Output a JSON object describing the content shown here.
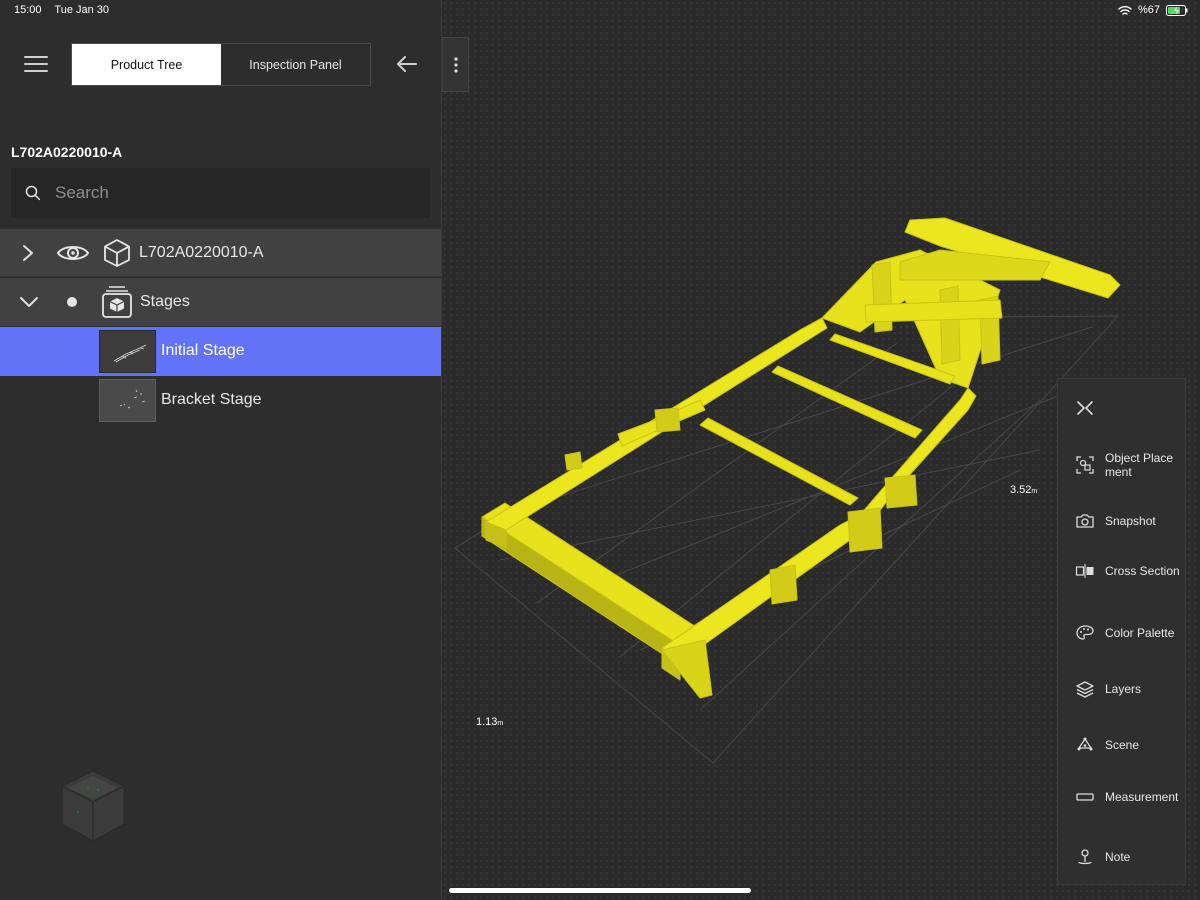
{
  "status_bar": {
    "time": "15:00",
    "date": "Tue Jan 30",
    "battery": "%67"
  },
  "header": {
    "tabs": [
      {
        "label": "Product Tree",
        "active": true
      },
      {
        "label": "Inspection Panel",
        "active": false
      }
    ]
  },
  "panel": {
    "part_title": "L702A0220010-A",
    "search": {
      "placeholder": "Search",
      "value": ""
    }
  },
  "tree": {
    "root_label": "L702A0220010-A",
    "stages_label": "Stages",
    "stages": [
      {
        "label": "Initial Stage",
        "selected": true
      },
      {
        "label": "Bracket Stage",
        "selected": false
      }
    ]
  },
  "viewer": {
    "dim_length": "3.52",
    "dim_width": "1.13",
    "dim_unit": "m",
    "model_color": "#e8e21c"
  },
  "toolbar": {
    "items": [
      {
        "label": "Object Placement",
        "icon": "object-placement-icon"
      },
      {
        "label": "Snapshot",
        "icon": "camera-icon"
      },
      {
        "label": "Cross Section",
        "icon": "cross-section-icon"
      },
      {
        "label": "Color Palette",
        "icon": "palette-icon"
      },
      {
        "label": "Layers",
        "icon": "layers-icon"
      },
      {
        "label": "Scene",
        "icon": "scene-icon"
      },
      {
        "label": "Measurement",
        "icon": "ruler-icon"
      },
      {
        "label": "Note",
        "icon": "note-pin-icon"
      }
    ]
  },
  "colors": {
    "selection": "#6273f7",
    "panel_bg": "#2d2d2d",
    "row_bg": "#414141"
  }
}
